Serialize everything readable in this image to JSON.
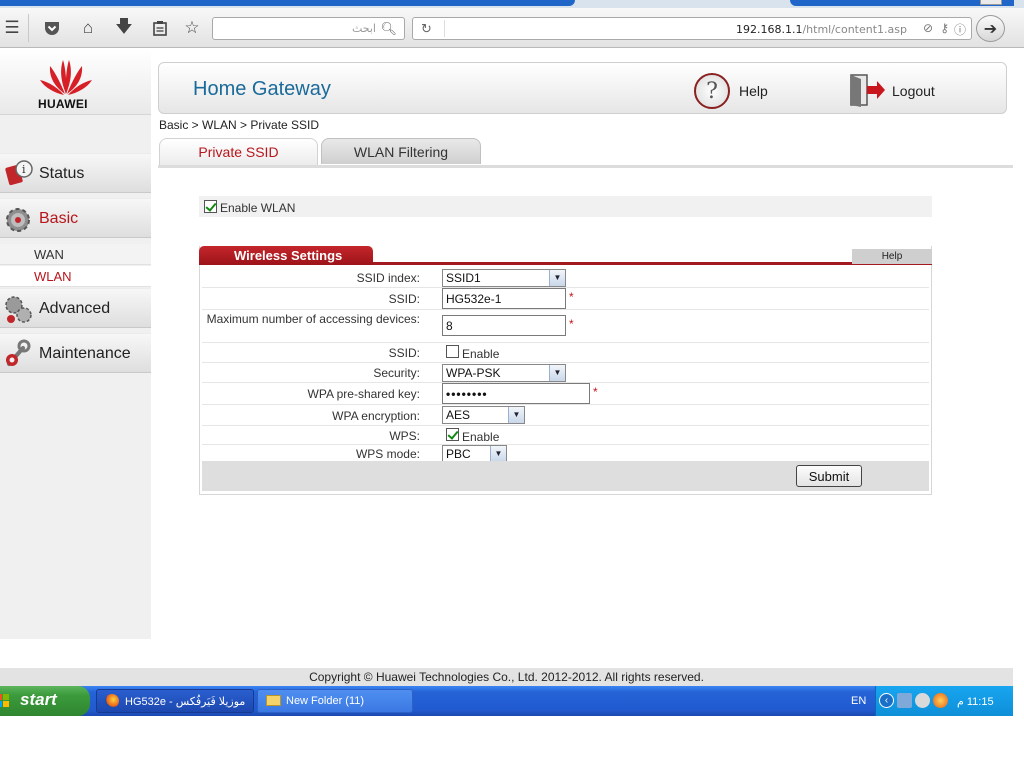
{
  "browser": {
    "search_placeholder": "ابحث",
    "url_host": "192.168.1.1",
    "url_path": "/html/content1.asp"
  },
  "logo": {
    "text": "HUAWEI"
  },
  "header": {
    "title": "Home Gateway",
    "help_label": "Help",
    "logout_label": "Logout"
  },
  "breadcrumb": "Basic > WLAN > Private SSID",
  "nav": {
    "items": [
      {
        "label": "Status"
      },
      {
        "label": "Basic"
      },
      {
        "label": "Advanced"
      },
      {
        "label": "Maintenance"
      }
    ],
    "subitems": [
      {
        "label": "WAN"
      },
      {
        "label": "WLAN"
      }
    ]
  },
  "tabs": [
    {
      "label": "Private SSID"
    },
    {
      "label": "WLAN Filtering"
    }
  ],
  "enable_wlan": {
    "label": "Enable WLAN",
    "checked": true
  },
  "wireless": {
    "title": "Wireless Settings",
    "help": "Help",
    "ssid_index": {
      "label": "SSID index:",
      "value": "SSID1"
    },
    "ssid": {
      "label": "SSID:",
      "value": "HG532e-1",
      "required": "*"
    },
    "max_devices": {
      "label": "Maximum number of accessing devices:",
      "value": "8",
      "required": "*"
    },
    "ssid_enable": {
      "label": "SSID:",
      "option": "Enable",
      "checked": false
    },
    "security": {
      "label": "Security:",
      "value": "WPA-PSK"
    },
    "wpa_key": {
      "label": "WPA pre-shared key:",
      "value": "••••••••",
      "required": "*"
    },
    "wpa_encryption": {
      "label": "WPA encryption:",
      "value": "AES"
    },
    "wps": {
      "label": "WPS:",
      "option": "Enable",
      "checked": true
    },
    "wps_mode": {
      "label": "WPS mode:",
      "value": "PBC"
    },
    "submit": "Submit"
  },
  "footer": {
    "copyright": "Copyright © Huawei Technologies Co., Ltd. 2012-2012. All rights reserved."
  },
  "taskbar": {
    "start": "start",
    "tasks": [
      {
        "label": "HG532e - موزيلا فَيَرفُكس"
      },
      {
        "label": "New Folder (11)"
      }
    ],
    "lang": "EN",
    "clock": "11:15 م"
  },
  "colors": {
    "brand_red": "#b8161c",
    "title_blue": "#1a6a9a",
    "taskbar_blue": "#245edb"
  }
}
